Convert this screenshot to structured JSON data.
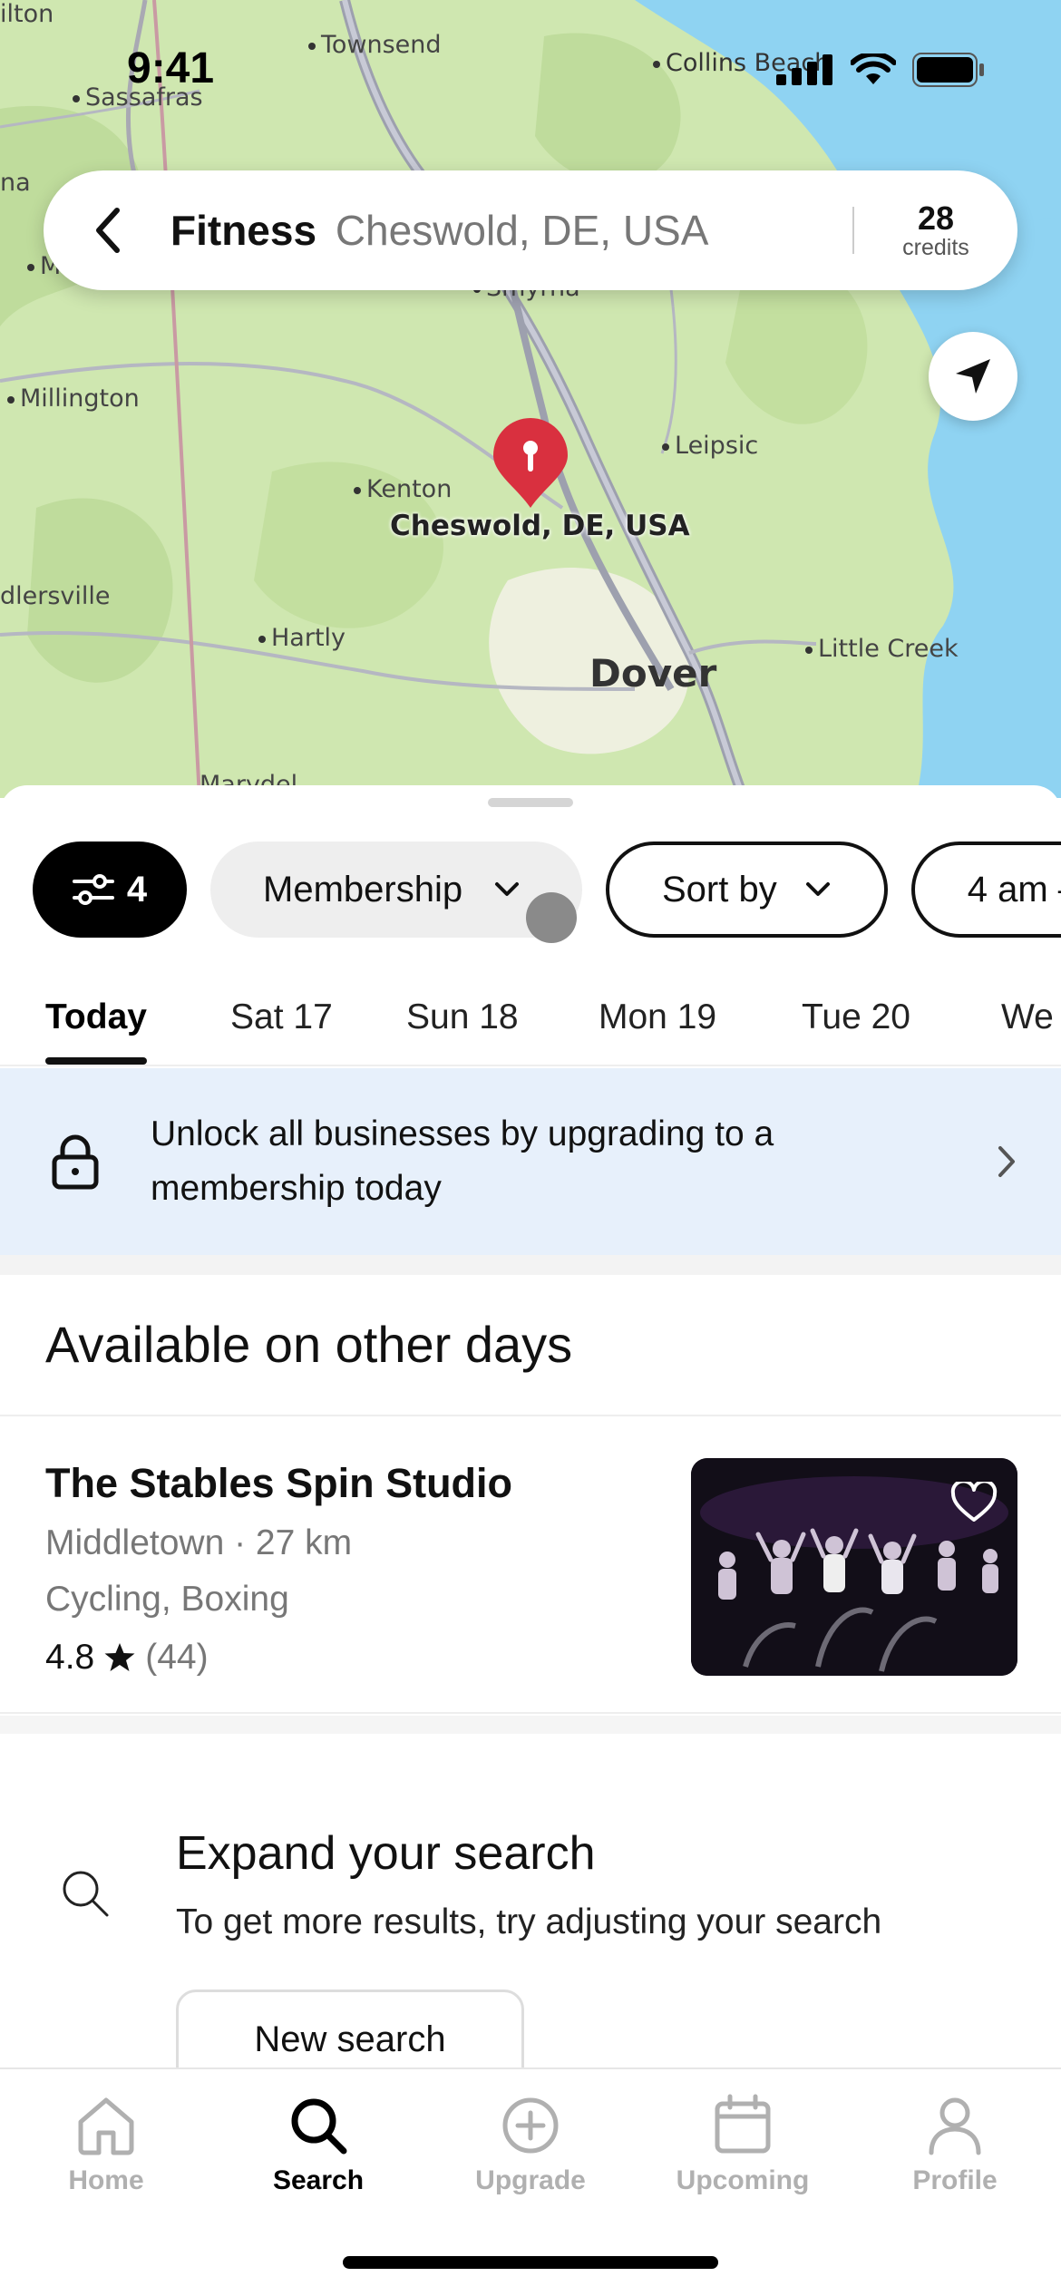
{
  "status_bar": {
    "time": "9:41"
  },
  "map": {
    "places": [
      "Townsend",
      "Sassafras",
      "Collins Beach",
      "Smyrna",
      "Millington",
      "Leipsic",
      "Kenton",
      "Hartly",
      "Little Creek",
      "Dover",
      "ilton",
      "dlersville",
      "na",
      "M",
      "Marydel"
    ],
    "pin_label": "Cheswold, DE, USA",
    "locate_icon": "navigation-arrow-icon"
  },
  "search_bar": {
    "category": "Fitness",
    "location": "Cheswold, DE, USA",
    "credits_value": "28",
    "credits_label": "credits"
  },
  "filters": {
    "filter_count": "4",
    "membership_label": "Membership",
    "sort_label": "Sort by",
    "time_label": "4 am –"
  },
  "days": [
    "Today",
    "Sat 17",
    "Sun 18",
    "Mon 19",
    "Tue 20",
    "We"
  ],
  "promo": {
    "text": "Unlock all businesses by upgrading to a membership today"
  },
  "section_title": "Available on other days",
  "listing": {
    "name": "The Stables Spin Studio",
    "location": "Middletown · 27 km",
    "categories": "Cycling, Boxing",
    "rating": "4.8",
    "review_count": "(44)"
  },
  "expand": {
    "title": "Expand your search",
    "subtitle": "To get more results, try adjusting your search",
    "button_label": "New search"
  },
  "tabs": [
    {
      "label": "Home",
      "icon": "home-icon",
      "active": false
    },
    {
      "label": "Search",
      "icon": "search-icon",
      "active": true
    },
    {
      "label": "Upgrade",
      "icon": "plus-circle-icon",
      "active": false
    },
    {
      "label": "Upcoming",
      "icon": "calendar-icon",
      "active": false
    },
    {
      "label": "Profile",
      "icon": "profile-icon",
      "active": false
    }
  ],
  "colors": {
    "accent": "#000000",
    "promo_bg": "#e7f0fb",
    "map_land": "#cfe7b0",
    "map_water": "#8fd3f2",
    "pin": "#d9303f"
  }
}
